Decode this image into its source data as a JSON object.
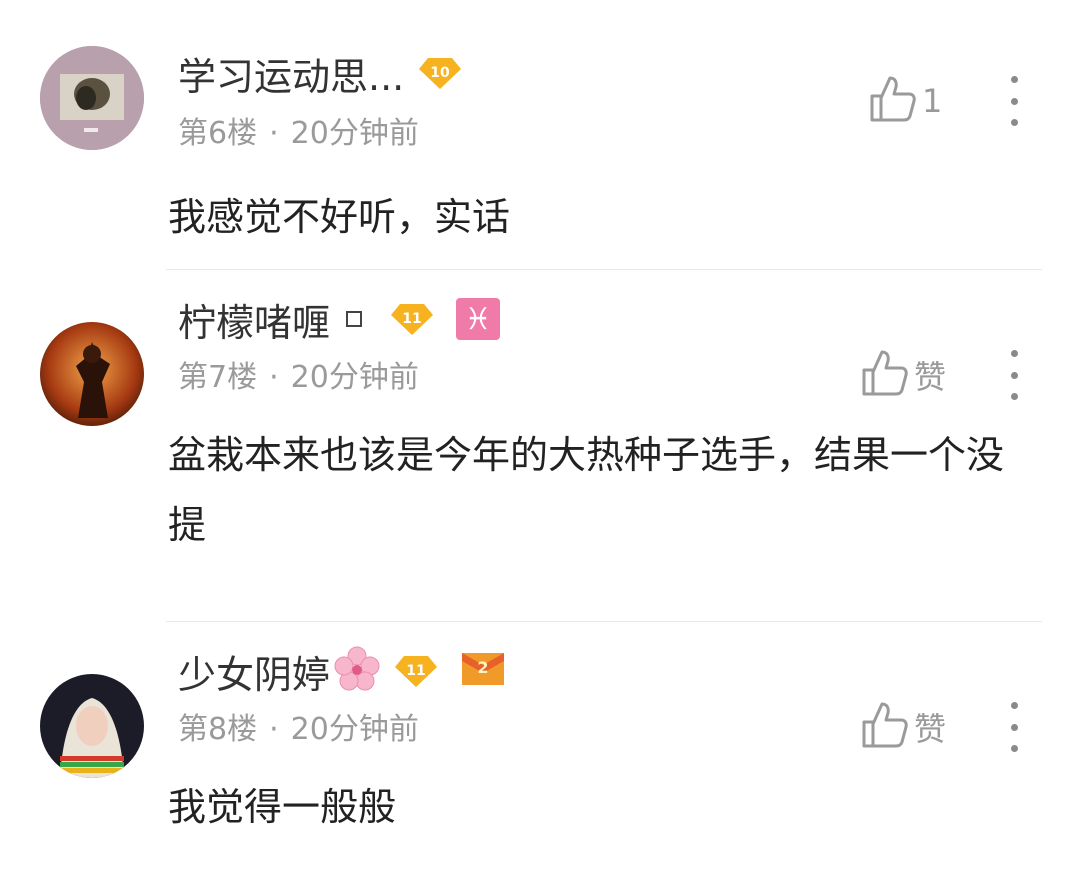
{
  "comments": [
    {
      "username": "学习运动思...",
      "level": "10",
      "floor": "第6楼",
      "time": "20分钟前",
      "likes": "1",
      "content": "我感觉不好听，实话"
    },
    {
      "username": "柠檬啫喱",
      "level": "11",
      "floor": "第7楼",
      "time": "20分钟前",
      "likes": "赞",
      "zodiac_symbol": "♓",
      "content": "盆栽本来也该是今年的大热种子选手，结果一个没提"
    },
    {
      "username": "少女阴婷",
      "level": "11",
      "floor": "第8楼",
      "time": "20分钟前",
      "likes": "赞",
      "rank_badge": "2",
      "content": "我觉得一般般"
    }
  ],
  "separator": "·",
  "colors": {
    "level_badge": "#f6b21f",
    "zodiac_badge": "#f07aa8",
    "meta_text": "#9a9a9a"
  }
}
